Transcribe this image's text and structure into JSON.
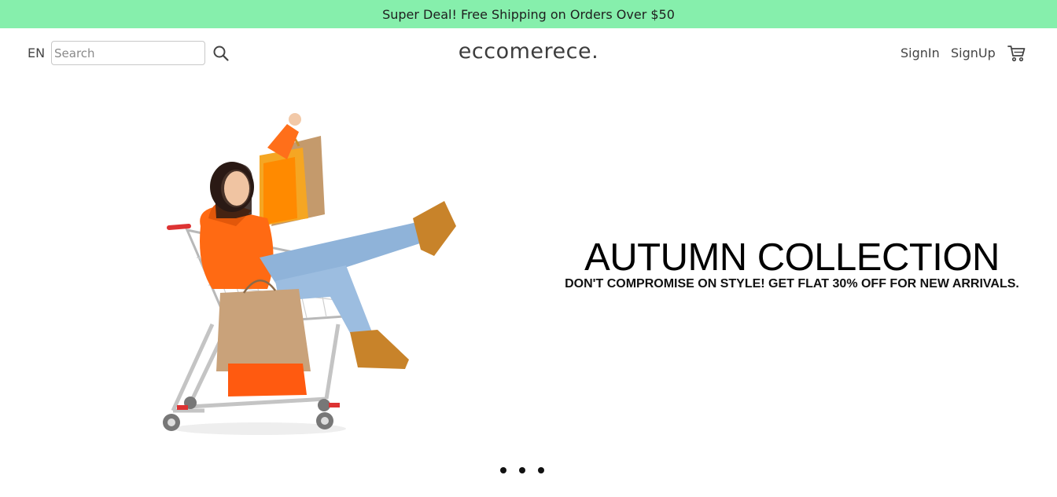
{
  "announcement": "Super Deal! Free Shipping on Orders Over $50",
  "header": {
    "language": "EN",
    "search_placeholder": "Search",
    "search_icon": "search-icon",
    "logo": "eccomerece.",
    "signin_label": "SignIn",
    "signup_label": "SignUp",
    "cart_icon": "cart-icon"
  },
  "hero": {
    "title": "AUTUMN COLLECTION",
    "subtitle": "DON'T COMPROMISE ON STYLE! GET FLAT 30% OFF FOR NEW ARRIVALS.",
    "image": "woman-in-shopping-cart-with-bags"
  },
  "slider": {
    "slide_count": 3
  },
  "colors": {
    "announce_bg": "#86efac",
    "text": "#333333"
  }
}
